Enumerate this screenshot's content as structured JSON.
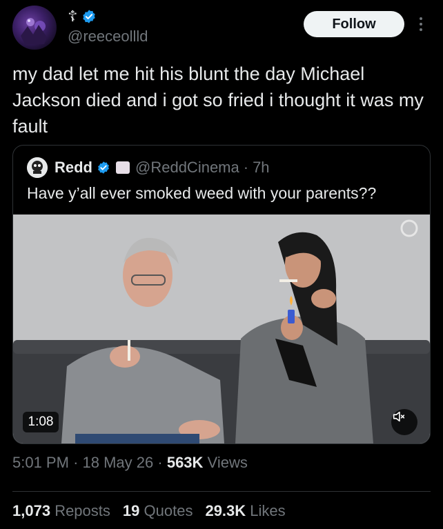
{
  "author": {
    "display_name": "☦",
    "handle": "@reeceollld",
    "verified": true
  },
  "follow_label": "Follow",
  "tweet_text": "my dad let me hit his blunt the day Michael Jackson died and i got so fried i thought it was my fault",
  "quote": {
    "name": "Redd",
    "handle": "@ReddCinema",
    "separator": "·",
    "time": "7h",
    "text": "Have y’all ever smoked weed with your parents??",
    "video_duration": "1:08"
  },
  "meta": {
    "time": "5:01 PM",
    "date": "18 May 26",
    "views_count": "563K",
    "views_label": "Views",
    "sep": "·"
  },
  "stats": {
    "reposts_count": "1,073",
    "reposts_label": "Reposts",
    "quotes_count": "19",
    "quotes_label": "Quotes",
    "likes_count": "29.3K",
    "likes_label": "Likes"
  },
  "colors": {
    "background": "#000000",
    "text": "#e7e9ea",
    "muted": "#71767b",
    "verified": "#1d9bf0",
    "border": "#2f3336"
  }
}
